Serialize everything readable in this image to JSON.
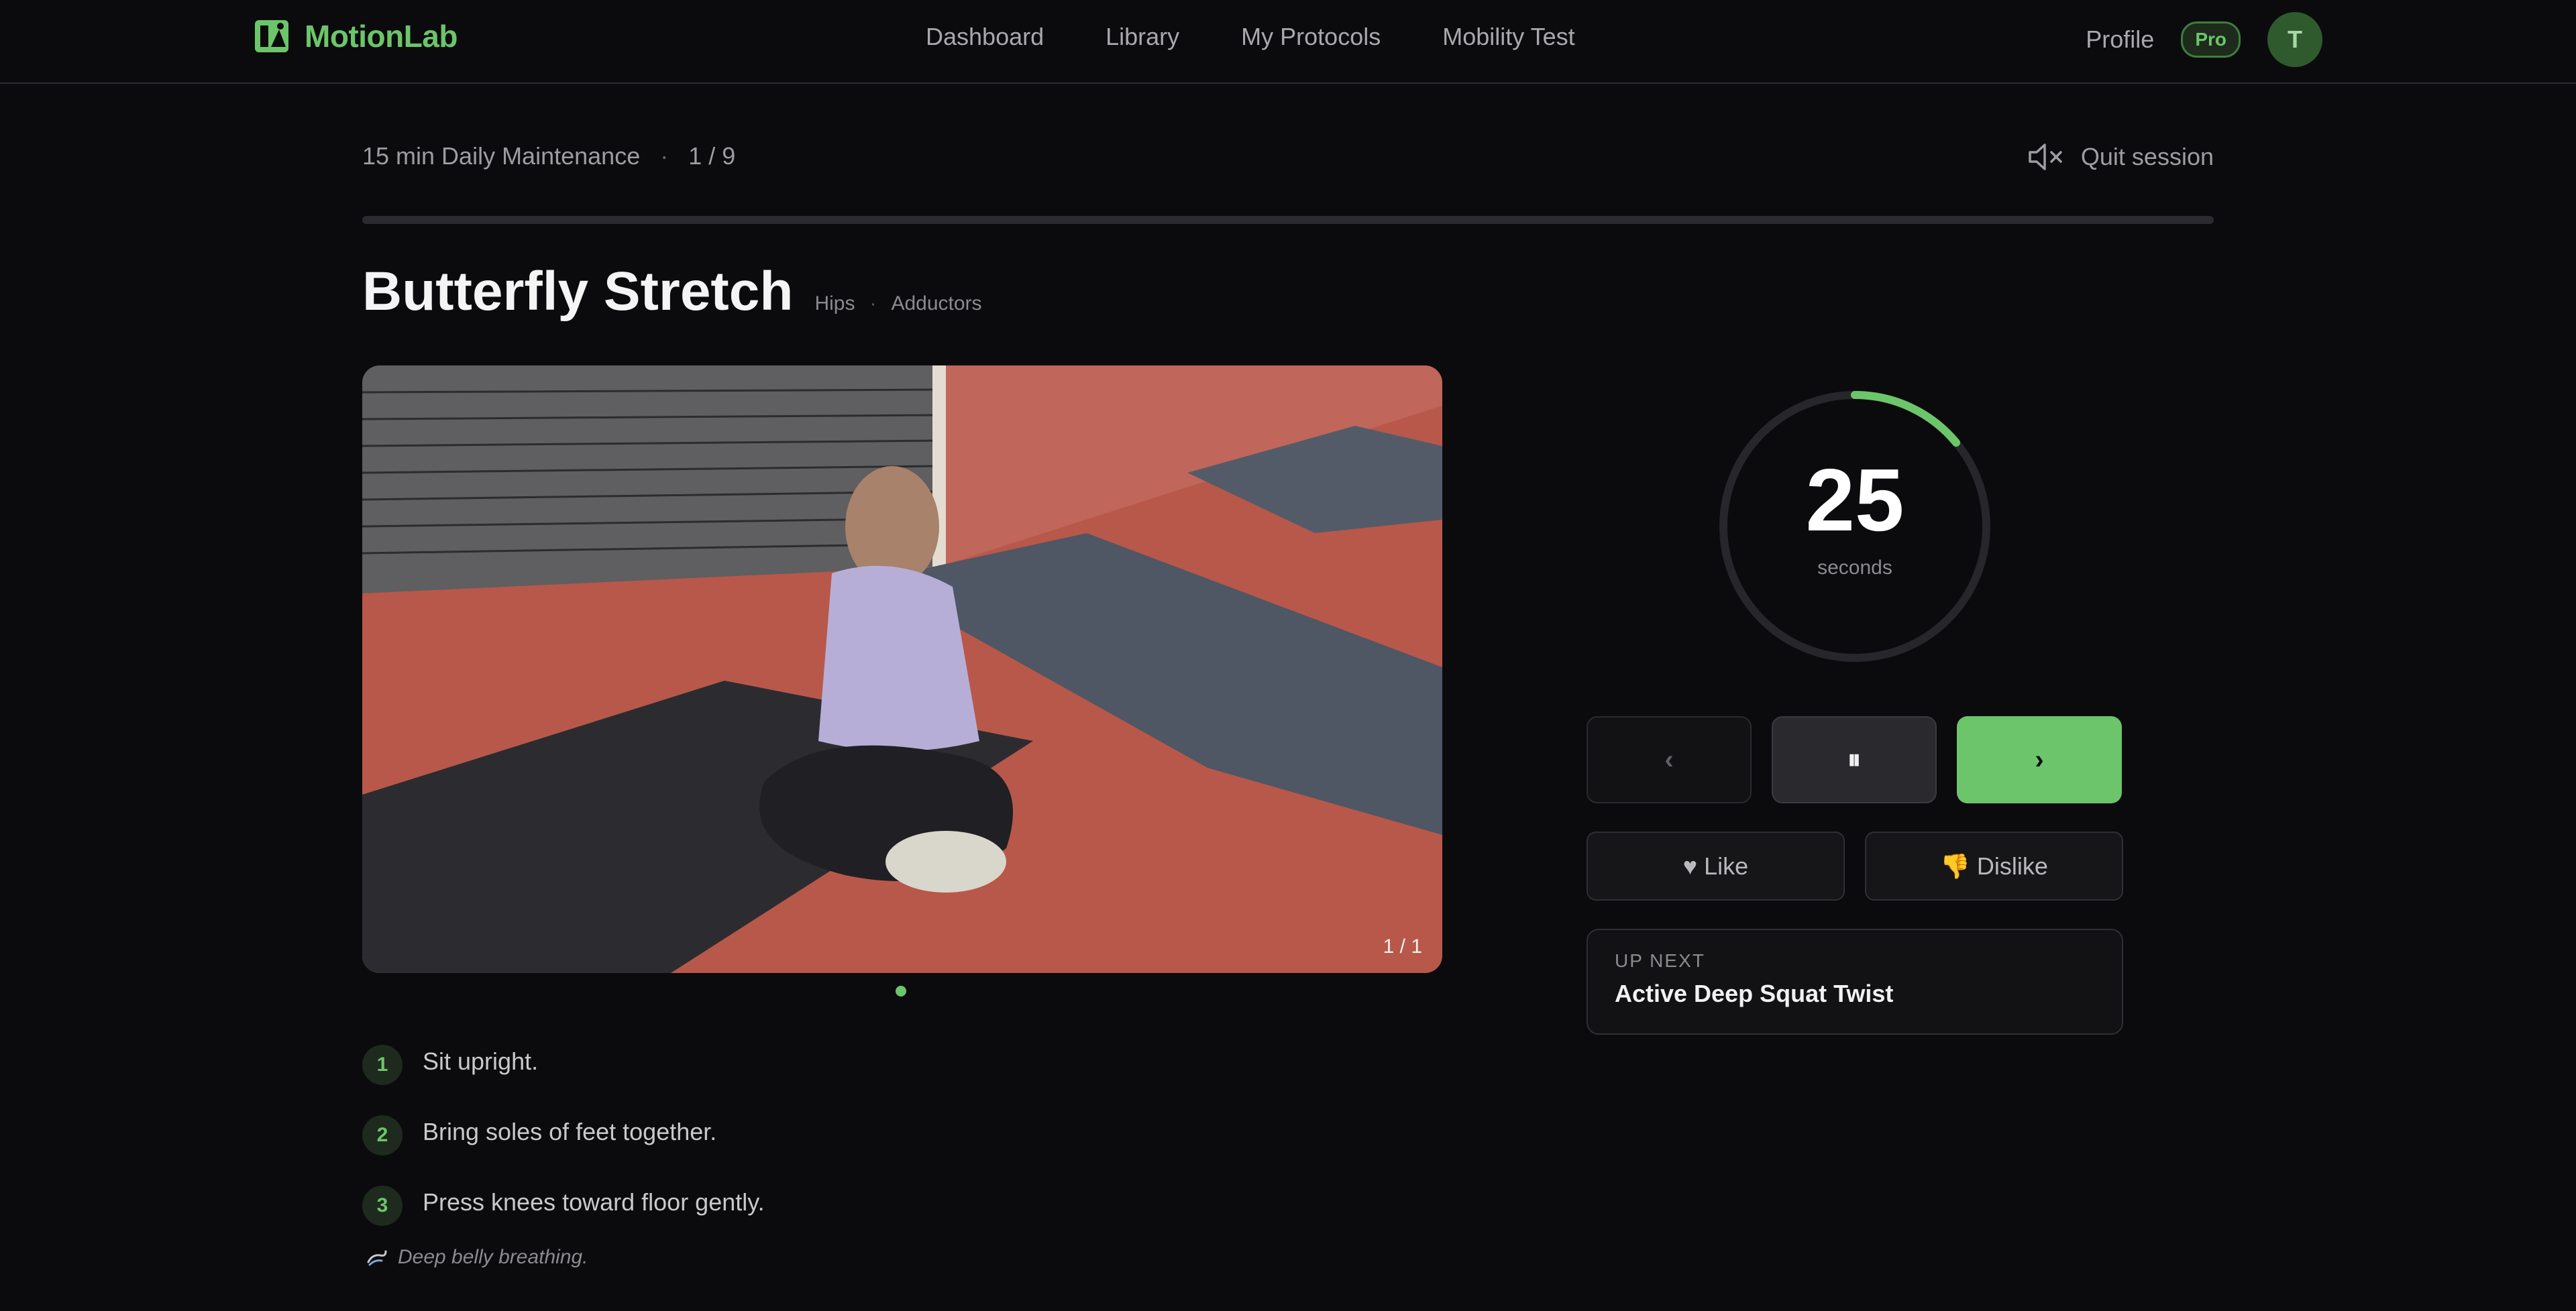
{
  "app": {
    "name": "MotionLab"
  },
  "nav": {
    "items": [
      {
        "label": "Dashboard"
      },
      {
        "label": "Library"
      },
      {
        "label": "My Protocols"
      },
      {
        "label": "Mobility Test"
      }
    ],
    "profile_label": "Profile",
    "plan_badge": "Pro",
    "avatar_initial": "T"
  },
  "session": {
    "protocol_name": "15 min Daily Maintenance",
    "separator": "·",
    "position": "1 / 9",
    "progress": 0.0,
    "quit_label": "Quit session",
    "mute_icon": "speaker-muted-icon"
  },
  "exercise": {
    "title": "Butterfly Stretch",
    "tags": [
      "Hips",
      "Adductors"
    ],
    "media_counter": "1 / 1",
    "steps": [
      {
        "number": "1",
        "text": "Sit upright."
      },
      {
        "number": "2",
        "text": "Bring soles of feet together."
      },
      {
        "number": "3",
        "text": "Press knees toward floor gently."
      }
    ],
    "tip": "Deep belly breathing.",
    "tip_icon": "breath-icon"
  },
  "timer": {
    "value": "25",
    "unit": "seconds",
    "remaining_fraction": 0.14
  },
  "controls": {
    "prev_label": "‹",
    "pause_label": "⏸",
    "next_label": "›",
    "like_label": "♥ Like",
    "dislike_label": "👎 Dislike"
  },
  "up_next": {
    "label": "UP NEXT",
    "title": "Active Deep Squat Twist"
  },
  "colors": {
    "accent": "#6cc56a",
    "background": "#0b0b0d"
  }
}
